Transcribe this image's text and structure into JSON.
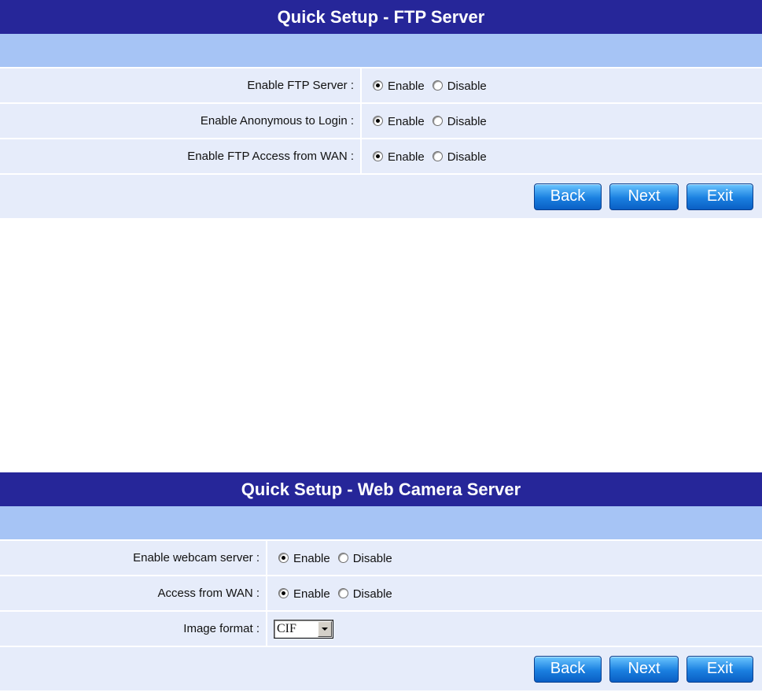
{
  "ftp": {
    "title": "Quick Setup - FTP Server",
    "rows": [
      {
        "label": "Enable FTP Server :",
        "enable": "Enable",
        "disable": "Disable",
        "selected": "enable"
      },
      {
        "label": "Enable Anonymous to Login :",
        "enable": "Enable",
        "disable": "Disable",
        "selected": "enable"
      },
      {
        "label": "Enable FTP Access from WAN :",
        "enable": "Enable",
        "disable": "Disable",
        "selected": "enable"
      }
    ],
    "buttons": {
      "back": "Back",
      "next": "Next",
      "exit": "Exit"
    }
  },
  "webcam": {
    "title": "Quick Setup - Web Camera Server",
    "rows": [
      {
        "label": "Enable webcam server :",
        "enable": "Enable",
        "disable": "Disable",
        "selected": "enable"
      },
      {
        "label": "Access from WAN :",
        "enable": "Enable",
        "disable": "Disable",
        "selected": "enable"
      }
    ],
    "image_format": {
      "label": "Image format :",
      "value": "CIF"
    },
    "buttons": {
      "back": "Back",
      "next": "Next",
      "exit": "Exit"
    }
  },
  "colors": {
    "title_bg": "#262699",
    "band_bg": "#a6c4f5",
    "row_bg": "#e6ecfa",
    "button": "#1a7fe0"
  }
}
